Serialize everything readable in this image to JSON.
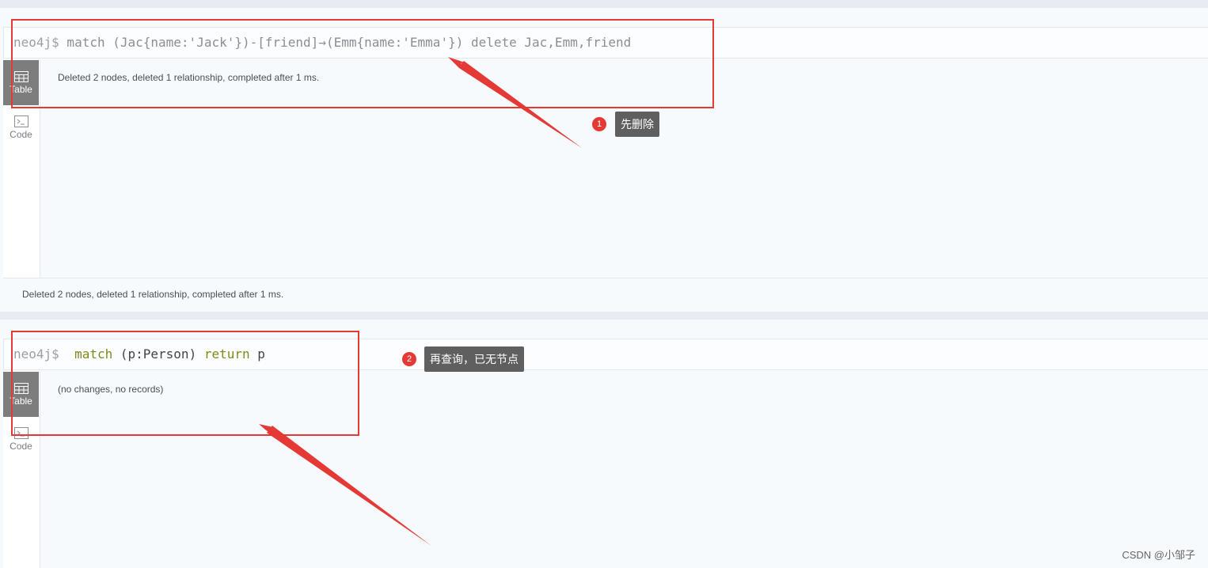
{
  "frames": [
    {
      "prompt": "neo4j$",
      "command": " match (Jac{name:'Jack'})-[friend]→(Emm{name:'Emma'}) delete Jac,Emm,friend",
      "result": "Deleted 2 nodes, deleted 1 relationship, completed after 1 ms.",
      "status": "Deleted 2 nodes, deleted 1 relationship, completed after 1 ms."
    },
    {
      "prompt": "neo4j$",
      "command_kw1": "match",
      "command_mid": " (p:Person) ",
      "command_kw2": "return",
      "command_tail": " p",
      "result": "(no changes, no records)"
    }
  ],
  "sidebar": {
    "table_label": "Table",
    "code_label": "Code"
  },
  "annotations": [
    {
      "number": "1",
      "text": "先删除"
    },
    {
      "number": "2",
      "text": "再查询，已无节点"
    }
  ],
  "watermark": "CSDN @小邹子",
  "colors": {
    "annotation_red": "#e53935",
    "callout_bg": "#5f5f5f",
    "active_tab": "#7d7d7d"
  }
}
